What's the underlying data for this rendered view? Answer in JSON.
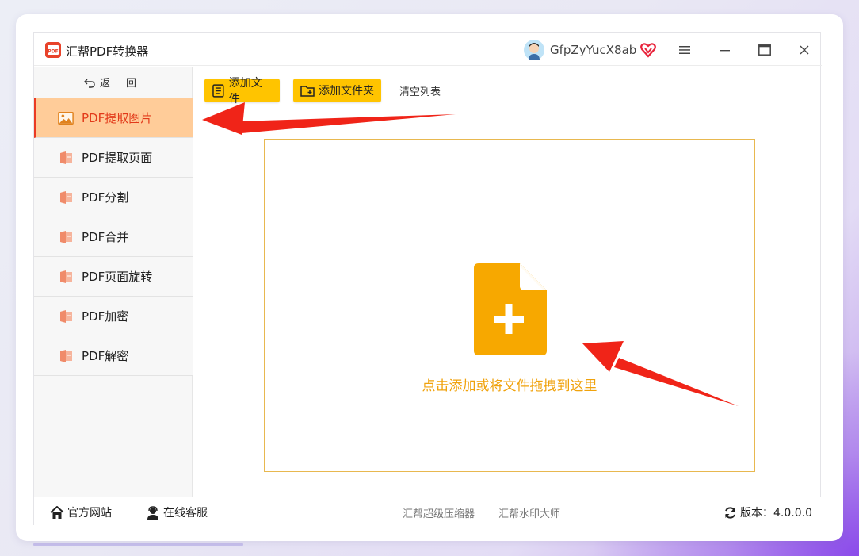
{
  "app": {
    "title": "汇帮PDF转换器",
    "logo_text": "PDF"
  },
  "user": {
    "name": "GfpZyYucX8ab"
  },
  "window_controls": [
    "menu-icon",
    "minimize-icon",
    "maximize-icon",
    "close-icon"
  ],
  "sidebar": {
    "back_label": "返 回",
    "items": [
      {
        "label": "PDF提取图片",
        "icon": "image-icon",
        "active": true
      },
      {
        "label": "PDF提取页面",
        "icon": "pdf-doc-icon"
      },
      {
        "label": "PDF分割",
        "icon": "pdf-doc-icon"
      },
      {
        "label": "PDF合并",
        "icon": "pdf-doc-icon"
      },
      {
        "label": "PDF页面旋转",
        "icon": "pdf-doc-icon"
      },
      {
        "label": "PDF加密",
        "icon": "pdf-doc-icon"
      },
      {
        "label": "PDF解密",
        "icon": "pdf-doc-icon"
      }
    ]
  },
  "toolbar": {
    "add_file_label": "添加文件",
    "add_folder_label": "添加文件夹",
    "clear_label": "清空列表"
  },
  "dropzone": {
    "text": "点击添加或将文件拖拽到这里"
  },
  "footer": {
    "website_label": "官方网站",
    "support_label": "在线客服",
    "compress_link": "汇帮超级压缩器",
    "watermark_link": "汇帮水印大师",
    "version_label": "版本：4.0.0.0"
  },
  "colors": {
    "accent_yellow": "#ffc400",
    "active_bg": "#ffcc99",
    "active_text": "#e23a1a",
    "drop_text": "#f0a20c",
    "annotation_arrow": "#f02418"
  }
}
